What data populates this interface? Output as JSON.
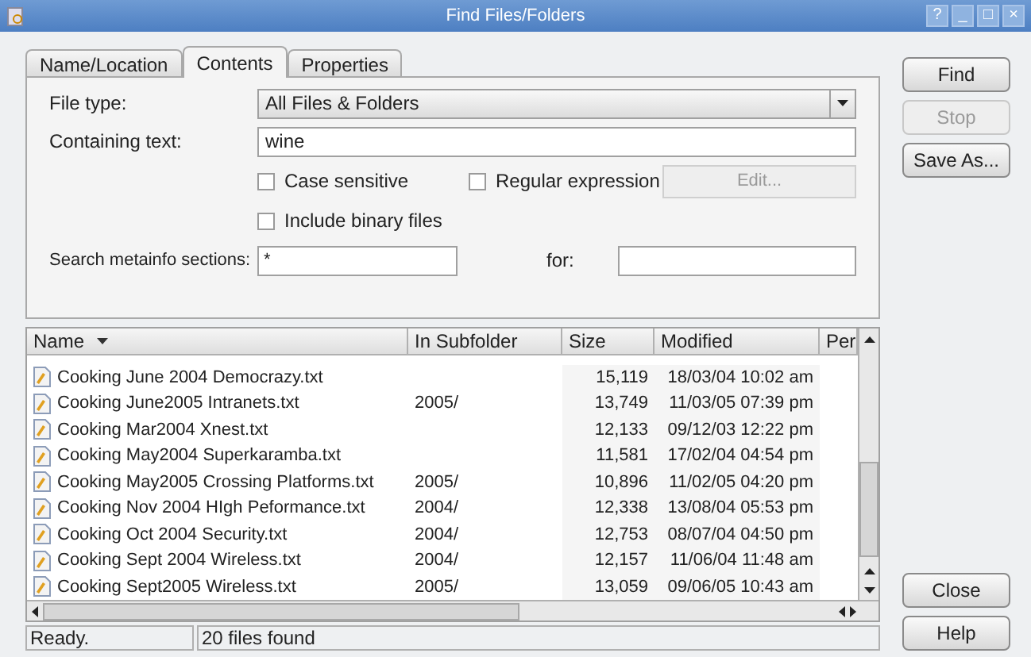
{
  "window": {
    "title": "Find Files/Folders",
    "controls": [
      "?",
      "_",
      "□",
      "×"
    ]
  },
  "tabs": [
    {
      "label": "Name/Location",
      "selected": false
    },
    {
      "label": "Contents",
      "selected": true
    },
    {
      "label": "Properties",
      "selected": false
    }
  ],
  "file_type": {
    "label": "File type:",
    "value": "All Files & Folders"
  },
  "containing_text": {
    "label": "Containing text:",
    "value": "wine"
  },
  "options": [
    {
      "label": "Case sensitive",
      "checked": false
    },
    {
      "label": "Regular expression",
      "checked": false
    },
    {
      "label": "Include binary files",
      "checked": false
    }
  ],
  "edit_button": {
    "label": "Edit...",
    "disabled": true
  },
  "metainfo": {
    "label": "Search metainfo sections:",
    "value": "*",
    "for_label": "for:"
  },
  "side_buttons": [
    {
      "label": "Find",
      "disabled": false
    },
    {
      "label": "Stop",
      "disabled": true
    },
    {
      "label": "Save As...",
      "disabled": false
    }
  ],
  "table": {
    "columns": [
      "Name",
      "In Subfolder",
      "Size",
      "Modified",
      "Per"
    ],
    "rows": [
      {
        "name": "Cooking June 2004 Democrazy.txt",
        "subfolder": "",
        "size": "15,119",
        "modified": "18/03/04 10:02 am"
      },
      {
        "name": "Cooking June2005 Intranets.txt",
        "subfolder": "2005/",
        "size": "13,749",
        "modified": "11/03/05 07:39 pm"
      },
      {
        "name": "Cooking Mar2004 Xnest.txt",
        "subfolder": "",
        "size": "12,133",
        "modified": "09/12/03 12:22 pm"
      },
      {
        "name": "Cooking May2004 Superkaramba.txt",
        "subfolder": "",
        "size": "11,581",
        "modified": "17/02/04 04:54 pm"
      },
      {
        "name": "Cooking May2005 Crossing Platforms.txt",
        "subfolder": "2005/",
        "size": "10,896",
        "modified": "11/02/05 04:20 pm"
      },
      {
        "name": "Cooking Nov 2004 HIgh Peformance.txt",
        "subfolder": "2004/",
        "size": "12,338",
        "modified": "13/08/04 05:53 pm"
      },
      {
        "name": "Cooking Oct 2004 Security.txt",
        "subfolder": "2004/",
        "size": "12,753",
        "modified": "08/07/04 04:50 pm"
      },
      {
        "name": "Cooking Sept 2004 Wireless.txt",
        "subfolder": "2004/",
        "size": "12,157",
        "modified": "11/06/04 11:48 am"
      },
      {
        "name": "Cooking Sept2005 Wireless.txt",
        "subfolder": "2005/",
        "size": "13,059",
        "modified": "09/06/05 10:43 am"
      }
    ]
  },
  "bottom_buttons": [
    {
      "label": "Close",
      "disabled": false
    },
    {
      "label": "Help",
      "disabled": false
    }
  ],
  "status_bar": [
    "Ready.",
    "20 files found"
  ]
}
